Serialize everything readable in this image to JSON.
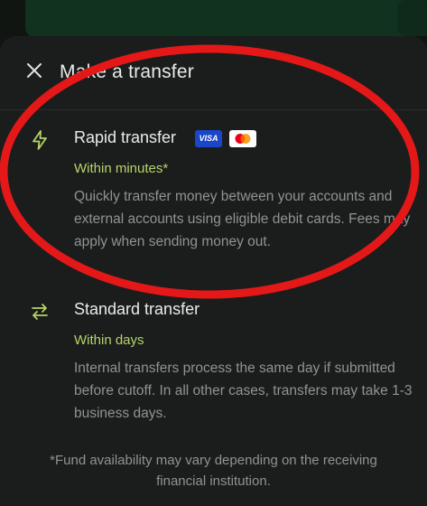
{
  "header": {
    "title": "Make a transfer",
    "close_icon": "close-icon"
  },
  "options": [
    {
      "icon": "lightning-icon",
      "title": "Rapid transfer",
      "badges": [
        "VISA",
        "mastercard"
      ],
      "subtitle": "Within minutes*",
      "description": "Quickly transfer money between your accounts and external accounts using eligible debit cards. Fees may apply when sending money out."
    },
    {
      "icon": "swap-arrows-icon",
      "title": "Standard transfer",
      "subtitle": "Within days",
      "description": "Internal transfers process the same day if submitted before cutoff. In all other cases, transfers may take 1-3 business days."
    }
  ],
  "footnote": "*Fund availability may vary depending on the receiving financial institution.",
  "colors": {
    "accent_green": "#b6d36a",
    "annotation_red": "#e41818",
    "sheet_bg": "#1b1d1c"
  }
}
